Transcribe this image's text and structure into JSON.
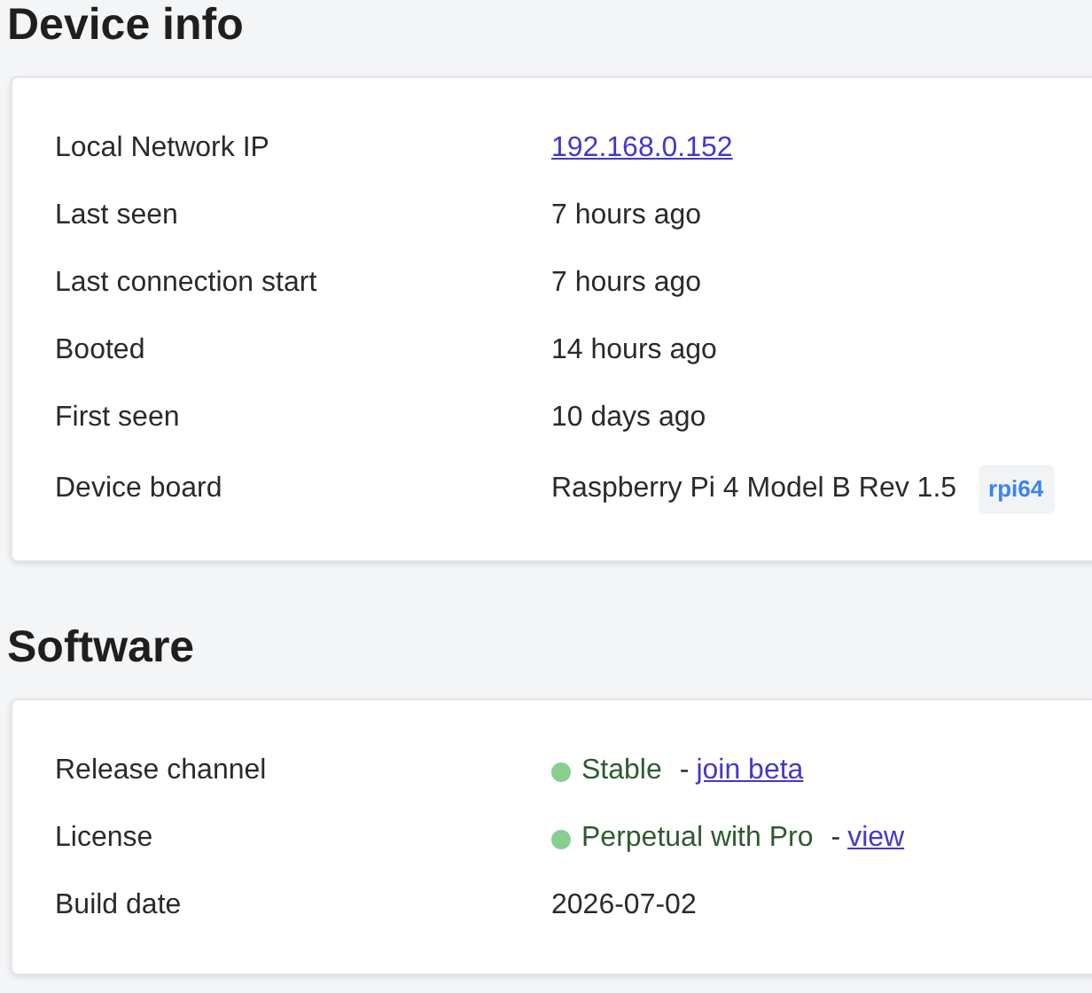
{
  "sections": [
    {
      "title": "Device info",
      "rows": [
        {
          "kind": "link",
          "label": "Local Network IP",
          "value": "192.168.0.152"
        },
        {
          "kind": "text",
          "label": "Last seen",
          "value": "7 hours ago"
        },
        {
          "kind": "text",
          "label": "Last connection start",
          "value": "7 hours ago"
        },
        {
          "kind": "text",
          "label": "Booted",
          "value": "14 hours ago"
        },
        {
          "kind": "text",
          "label": "First seen",
          "value": "10 days ago"
        },
        {
          "kind": "tag",
          "label": "Device board",
          "value": "Raspberry Pi 4 Model B Rev 1.5",
          "tag": "rpi64"
        }
      ]
    },
    {
      "title": "Software",
      "rows": [
        {
          "kind": "status",
          "label": "Release channel",
          "value": "Stable",
          "separator": "-",
          "link": "join beta"
        },
        {
          "kind": "status",
          "label": "License",
          "value": "Perpetual with Pro",
          "separator": "-",
          "link": "view"
        },
        {
          "kind": "text",
          "label": "Build date",
          "value": "2026-07-02"
        }
      ]
    }
  ]
}
